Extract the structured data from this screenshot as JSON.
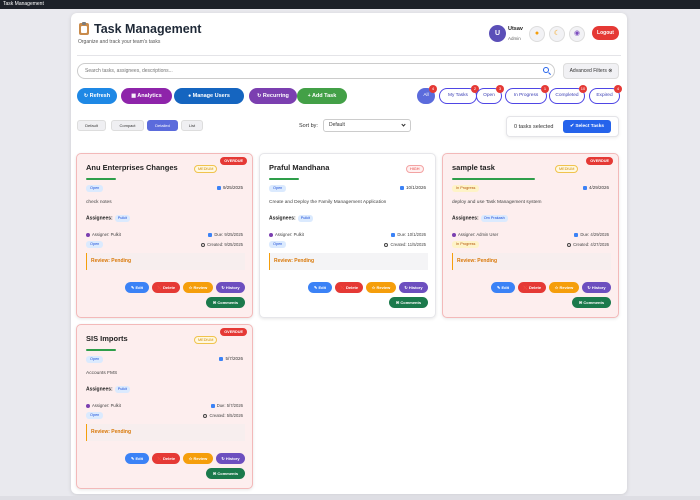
{
  "window": {
    "title": "Task Management"
  },
  "header": {
    "title": "Task Management",
    "subtitle": "Organize and track your team's tasks",
    "user": {
      "initial": "U",
      "name": "Utsav",
      "role": "Admin"
    },
    "icon_buttons": [
      "bell-icon",
      "moon-icon",
      "palette-icon"
    ],
    "logout_label": "Logout"
  },
  "search": {
    "placeholder": "Search tasks, assignees, descriptions...",
    "advanced_label": "Advanced Filters"
  },
  "actions": [
    {
      "label": "Refresh",
      "color": "#1e88e5"
    },
    {
      "label": "Analytics",
      "color": "#8e24aa"
    },
    {
      "label": "Manage Users",
      "color": "#1565c0"
    },
    {
      "label": "Recurring",
      "color": "#7b3fb0"
    },
    {
      "label": "Add Task",
      "color": "#43a047"
    }
  ],
  "filters": [
    {
      "label": "All",
      "count": "4",
      "active": true
    },
    {
      "label": "My Tasks",
      "count": "2",
      "active": false
    },
    {
      "label": "Open",
      "count": "3",
      "active": false
    },
    {
      "label": "In Progress",
      "count": "1",
      "active": false
    },
    {
      "label": "Completed",
      "count": "10",
      "active": false
    },
    {
      "label": "Expired",
      "count": "4",
      "active": false
    }
  ],
  "view_modes": [
    {
      "label": "Default",
      "active": false
    },
    {
      "label": "Compact",
      "active": false
    },
    {
      "label": "Detailed",
      "active": true
    },
    {
      "label": "List",
      "active": false
    }
  ],
  "sort": {
    "label": "Sort by:",
    "value": "Default"
  },
  "selection": {
    "count_text": "0 tasks selected",
    "button_label": "Select Tasks"
  },
  "tasks": [
    {
      "title": "Anu Enterprises Changes",
      "priority": "MEDIUM",
      "overdue": "OVERDUE",
      "status": "Open",
      "date": "9/25/2025",
      "description": "check notes",
      "assignees_label": "Assignees:",
      "assignee": "Pulkit",
      "assigner": "Assigner: Pulkit",
      "due": "Due: 9/25/2025",
      "status_small": "Open",
      "created": "Created: 9/25/2025",
      "review": "Review: Pending",
      "progress": 0.2
    },
    {
      "title": "Praful Mandhana",
      "priority": "HIGH",
      "overdue": "",
      "status": "Open",
      "date": "10/1/2026",
      "description": "Create and Deploy the Family Management Application",
      "assignees_label": "Assignees:",
      "assignee": "Pulkit",
      "assigner": "Assigner: Pulkit",
      "due": "Due: 10/1/2026",
      "status_small": "Open",
      "created": "Created: 11/5/2025",
      "review": "Review: Pending",
      "progress": 0.2
    },
    {
      "title": "sample task",
      "priority": "MEDIUM",
      "overdue": "OVERDUE",
      "status": "In Progress",
      "date": "4/29/2026",
      "description": "deploy and use Task Management system",
      "assignees_label": "Assignees:",
      "assignee": "Om Prakash",
      "assigner": "Assigner: Admin User",
      "due": "Due: 4/29/2026",
      "status_small": "In Progress",
      "created": "Created: 4/27/2026",
      "review": "Review: Pending",
      "progress": 0.55
    },
    {
      "title": "SIS Imports",
      "priority": "MEDIUM",
      "overdue": "OVERDUE",
      "status": "Open",
      "date": "5/7/2026",
      "description": "Accounts FMS",
      "assignees_label": "Assignees:",
      "assignee": "Pulkit",
      "assigner": "Assigner: Pulkit",
      "due": "Due: 5/7/2026",
      "status_small": "Open",
      "created": "Created: 5/5/2026",
      "review": "Review: Pending",
      "progress": 0.2
    }
  ],
  "card_buttons": {
    "edit": "Edit",
    "delete": "Delete",
    "review": "Review",
    "history": "History",
    "comments": "Comments"
  }
}
